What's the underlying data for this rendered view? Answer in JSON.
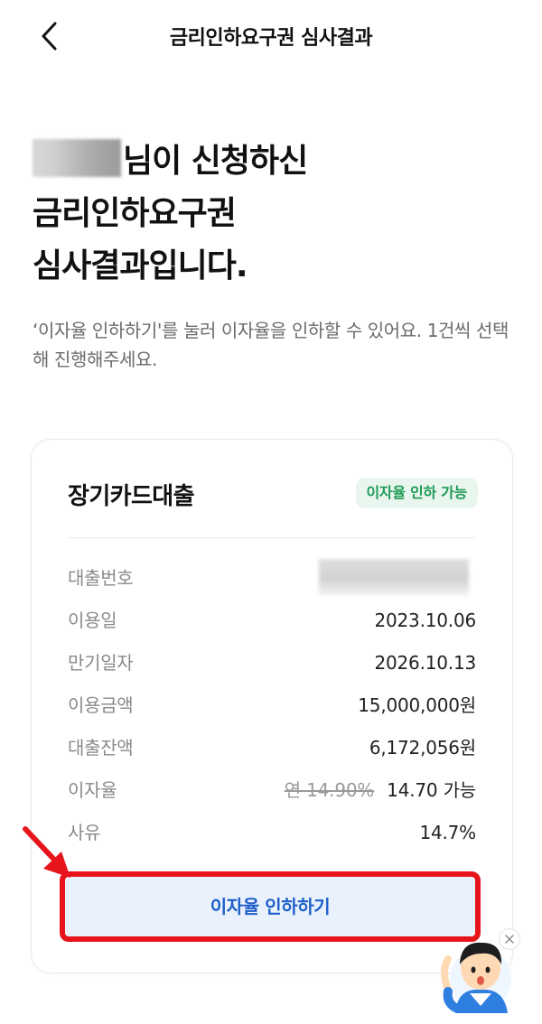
{
  "header": {
    "title": "금리인하요구권 심사결과"
  },
  "headline": {
    "line1_suffix": "님이 신청하신",
    "line2": "금리인하요구권",
    "line3": "심사결과입니다."
  },
  "description": "‘이자율 인하하기'를 눌러 이자율을 인하할 수 있어요. 1건씩 선택해 진행해주세요.",
  "card": {
    "title": "장기카드대출",
    "badge": "이자율 인하 가능",
    "rows": [
      {
        "label": "대출번호",
        "value": ""
      },
      {
        "label": "이용일",
        "value": "2023.10.06"
      },
      {
        "label": "만기일자",
        "value": "2026.10.13"
      },
      {
        "label": "이용금액",
        "value": "15,000,000원"
      },
      {
        "label": "대출잔액",
        "value": "6,172,056원"
      },
      {
        "label": "이자율",
        "old_value": "연 14.90%",
        "value": "14.70 가능"
      },
      {
        "label": "사유",
        "value": "14.7%"
      }
    ],
    "action_label": "이자율 인하하기"
  },
  "colors": {
    "badge_text": "#1f9a55",
    "badge_bg": "#e8f6ee",
    "action_text": "#1f5fc8",
    "action_bg": "#e9f1fd",
    "highlight": "#e8141c"
  },
  "icons": {
    "back": "chevron-left-icon",
    "annotation": "arrow-icon",
    "mascot": "chatbot-mascot-icon",
    "close": "close-icon"
  }
}
